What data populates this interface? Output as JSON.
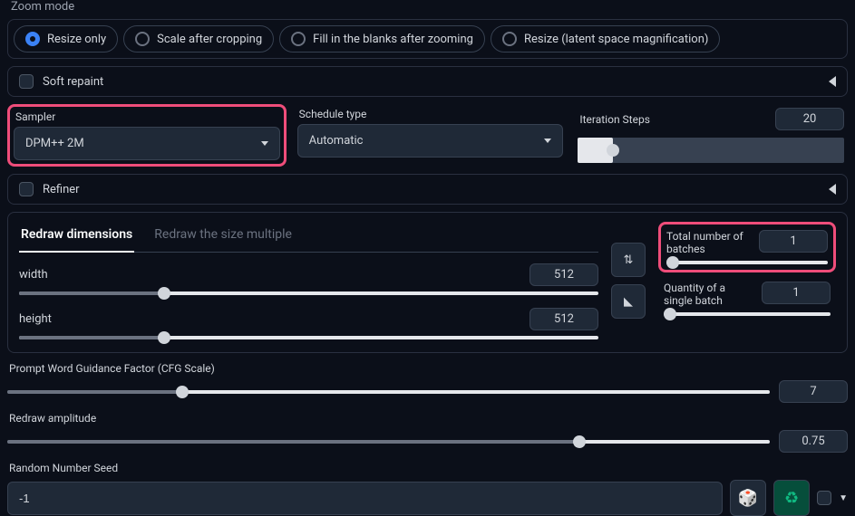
{
  "zoom_mode": {
    "label": "Zoom mode",
    "options": [
      {
        "label": "Resize only",
        "selected": true
      },
      {
        "label": "Scale after cropping",
        "selected": false
      },
      {
        "label": "Fill in the blanks after zooming",
        "selected": false
      },
      {
        "label": "Resize (latent space magnification)",
        "selected": false
      }
    ]
  },
  "soft_repaint": {
    "label": "Soft repaint"
  },
  "sampler": {
    "label": "Sampler",
    "value": "DPM++ 2M"
  },
  "schedule_type": {
    "label": "Schedule type",
    "value": "Automatic"
  },
  "iteration_steps": {
    "label": "Iteration Steps",
    "value": "20",
    "fill_pct": 13
  },
  "refiner": {
    "label": "Refiner"
  },
  "tabs": {
    "redraw_dimensions": "Redraw dimensions",
    "redraw_multiple": "Redraw the size multiple"
  },
  "width": {
    "label": "width",
    "value": "512",
    "fill_pct": 25
  },
  "height": {
    "label": "height",
    "value": "512",
    "fill_pct": 25
  },
  "total_batches": {
    "label": "Total number of batches",
    "value": "1",
    "fill_pct": 0
  },
  "qty_single_batch": {
    "label": "Quantity of a single batch",
    "value": "1",
    "fill_pct": 0
  },
  "cfg_scale": {
    "label": "Prompt Word Guidance Factor (CFG Scale)",
    "value": "7",
    "fill_pct": 23
  },
  "redraw_amplitude": {
    "label": "Redraw amplitude",
    "value": "0.75",
    "fill_pct": 75
  },
  "seed": {
    "label": "Random Number Seed",
    "value": "-1"
  },
  "icons": {
    "swap": "⇅",
    "ruler": "◣",
    "dice": "🎲",
    "recycle": "♻",
    "dropdown": "▼"
  }
}
